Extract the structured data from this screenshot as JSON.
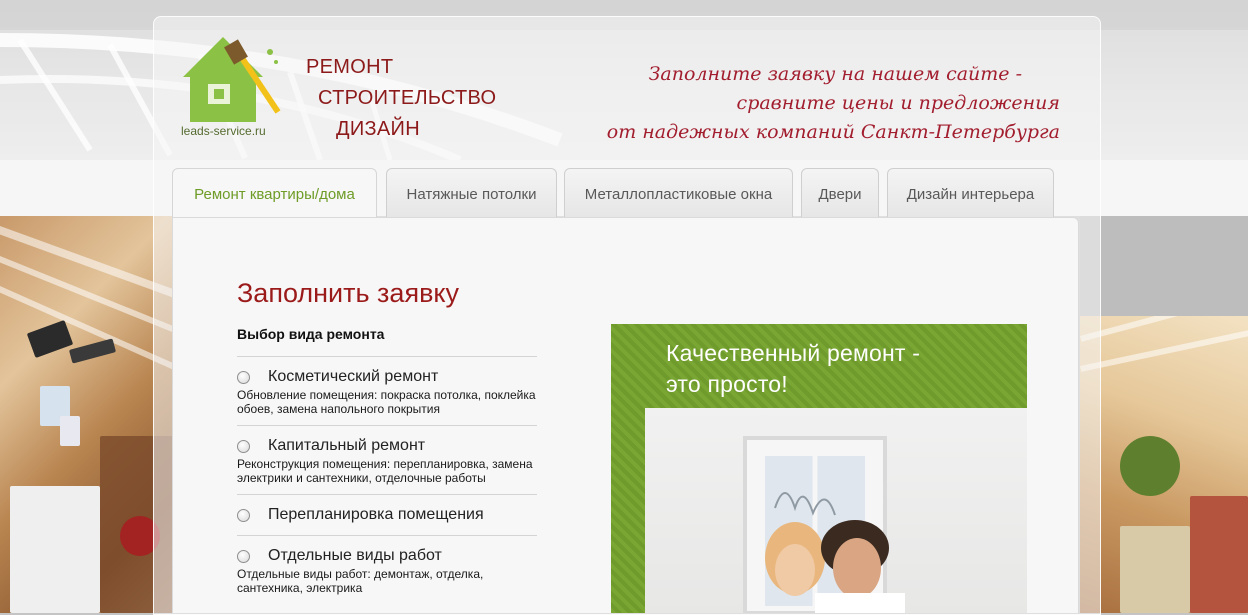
{
  "site": {
    "logo_text": "leads-service.ru",
    "slogan": [
      "РЕМОНТ",
      "СТРОИТЕЛЬСТВО",
      "ДИЗАЙН"
    ],
    "tagline": [
      "Заполните заявку на нашем сайте -",
      "сравните цены и предложения",
      "от надежных компаний Санкт-Петербурга"
    ]
  },
  "tabs": [
    {
      "label": "Ремонт квартиры/дома",
      "active": true
    },
    {
      "label": "Натяжные потолки",
      "active": false
    },
    {
      "label": "Металлопластиковые окна",
      "active": false
    },
    {
      "label": "Двери",
      "active": false
    },
    {
      "label": "Дизайн интерьера",
      "active": false
    }
  ],
  "form": {
    "title": "Заполнить заявку",
    "subtitle": "Выбор вида ремонта",
    "options": [
      {
        "label": "Косметический ремонт",
        "desc": "Обновление помещения: покраска потолка, поклейка обоев, замена напольного покрытия"
      },
      {
        "label": "Капитальный ремонт",
        "desc": "Реконструкция помещения: перепланировка, замена электрики и сантехники, отделочные работы"
      },
      {
        "label": "Перепланировка помещения",
        "desc": ""
      },
      {
        "label": "Отдельные виды работ",
        "desc": "Отдельные виды работ: демонтаж, отделка, сантехника, электрика"
      }
    ]
  },
  "promo": {
    "lines": [
      "Качественный ремонт -",
      "это просто!"
    ]
  },
  "colors": {
    "accent_green": "#6e9c27",
    "heading_red": "#9b1a1a",
    "tagline_red": "#a21d2e"
  }
}
